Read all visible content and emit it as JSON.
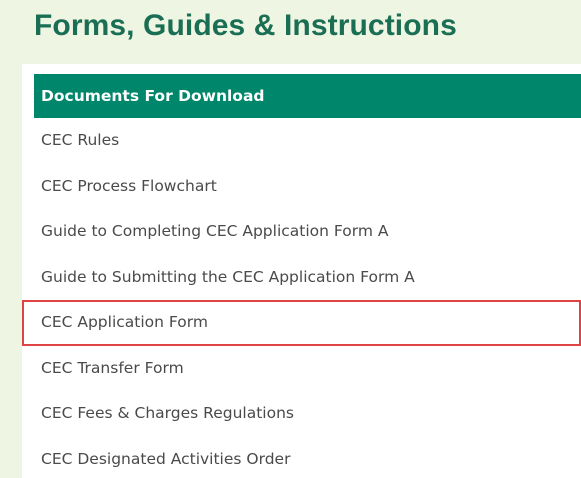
{
  "page": {
    "title": "Forms, Guides & Instructions"
  },
  "table": {
    "header": "Documents For Download",
    "items": [
      {
        "label": "CEC Rules",
        "highlighted": false
      },
      {
        "label": "CEC Process Flowchart",
        "highlighted": false
      },
      {
        "label": "Guide to Completing CEC Application Form A",
        "highlighted": false
      },
      {
        "label": "Guide to Submitting the CEC Application Form A",
        "highlighted": false
      },
      {
        "label": "CEC Application Form",
        "highlighted": true
      },
      {
        "label": "CEC Transfer Form",
        "highlighted": false
      },
      {
        "label": "CEC Fees & Charges Regulations",
        "highlighted": false
      },
      {
        "label": "CEC Designated Activities Order",
        "highlighted": false
      }
    ]
  },
  "colors": {
    "title": "#1a6e53",
    "header_bg": "#00866a",
    "highlight_border": "#e04343",
    "page_bg": "#eef5e2"
  }
}
